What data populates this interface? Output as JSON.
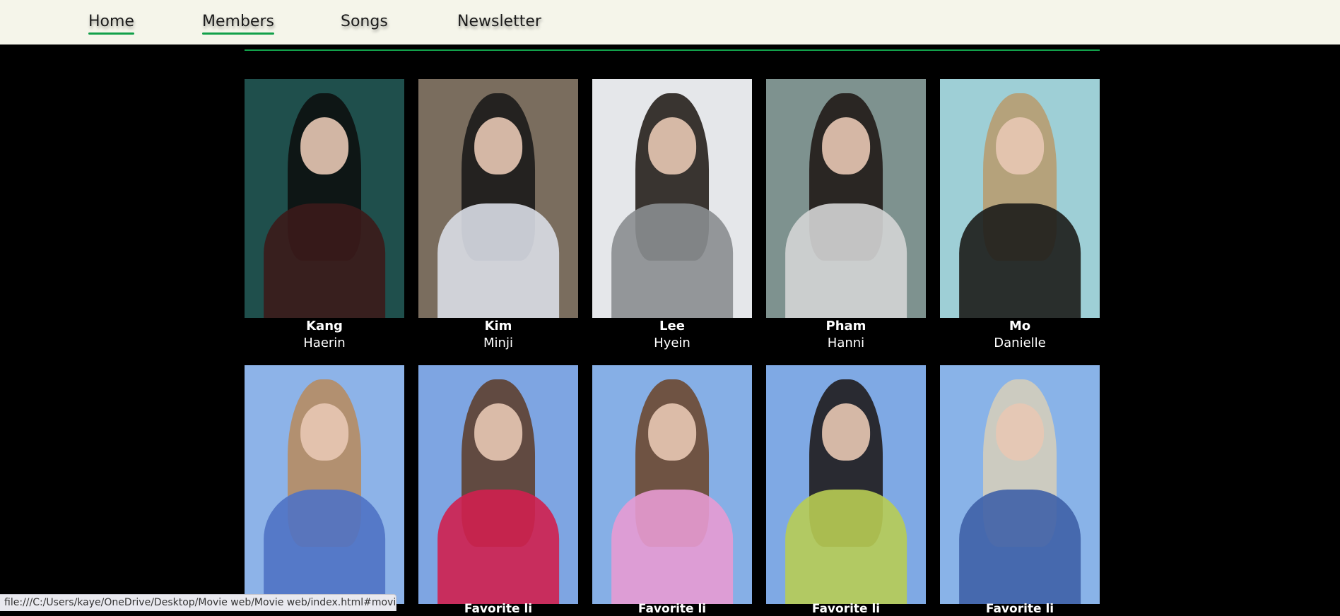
{
  "nav": {
    "links": [
      {
        "label": "Home",
        "active": true
      },
      {
        "label": "Members",
        "active": true
      },
      {
        "label": "Songs",
        "active": false
      },
      {
        "label": "Newsletter",
        "active": false
      }
    ]
  },
  "members": [
    {
      "first": "Kang",
      "second": "Haerin",
      "bg": "#1f4f4c",
      "hair": "#0c0c0c",
      "body": "#3b1a1a"
    },
    {
      "first": "Kim",
      "second": "Minji",
      "bg": "#7a6d5e",
      "hair": "#151515",
      "body": "#d9dde6"
    },
    {
      "first": "Lee",
      "second": "Hyein",
      "bg": "#e5e7ea",
      "hair": "#1b140f",
      "body": "#8a8d90"
    },
    {
      "first": "Pham",
      "second": "Hanni",
      "bg": "#7e928f",
      "hair": "#1b1311",
      "body": "#d4d5d5"
    },
    {
      "first": "Mo",
      "second": "Danielle",
      "bg": "#9ecfd6",
      "hair": "#b99a6b",
      "body": "#1c1c1a"
    }
  ],
  "gallery": [
    {
      "bg": "#8db3e8",
      "hair": "#b98a5a",
      "body": "#4f72c4",
      "label": "Favorite li"
    },
    {
      "bg": "#7ea5e2",
      "hair": "#5c3a25",
      "body": "#d0204f",
      "label": "Favorite li"
    },
    {
      "bg": "#86afe6",
      "hair": "#6b4326",
      "body": "#e79bd3",
      "label": "Favorite li"
    },
    {
      "bg": "#7fa9e4",
      "hair": "#1a1412",
      "body": "#b8cc54",
      "label": "Favorite li"
    },
    {
      "bg": "#89b3e8",
      "hair": "#d8cfb9",
      "body": "#3f61a7",
      "label": "Favorite li"
    }
  ],
  "status_url": "file:///C:/Users/kaye/OneDrive/Desktop/Movie web/Movie web/index.html#movies"
}
